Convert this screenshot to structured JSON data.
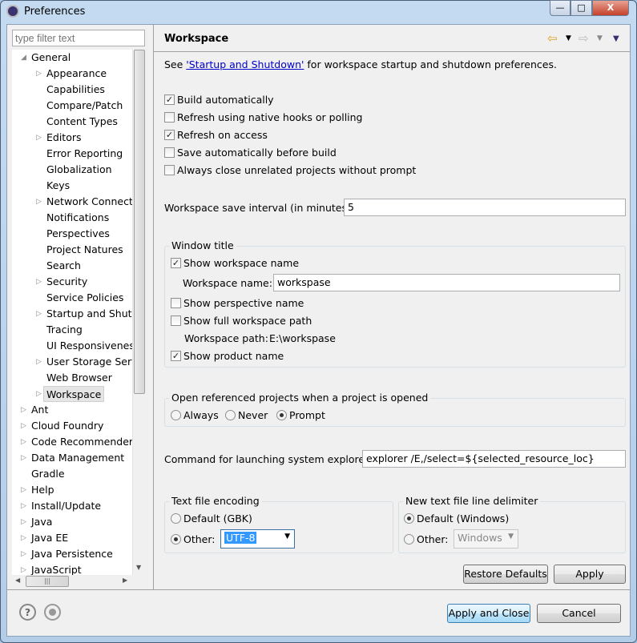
{
  "window": {
    "title": "Preferences",
    "minimize": "—",
    "maximize": "□",
    "close": "X"
  },
  "filter": {
    "placeholder": "type filter text"
  },
  "tree": [
    {
      "label": "General",
      "level": 0,
      "arrow": "expanded"
    },
    {
      "label": "Appearance",
      "level": 1,
      "arrow": "collapsed"
    },
    {
      "label": "Capabilities",
      "level": 1,
      "arrow": "none"
    },
    {
      "label": "Compare/Patch",
      "level": 1,
      "arrow": "none"
    },
    {
      "label": "Content Types",
      "level": 1,
      "arrow": "none"
    },
    {
      "label": "Editors",
      "level": 1,
      "arrow": "collapsed"
    },
    {
      "label": "Error Reporting",
      "level": 1,
      "arrow": "none"
    },
    {
      "label": "Globalization",
      "level": 1,
      "arrow": "none"
    },
    {
      "label": "Keys",
      "level": 1,
      "arrow": "none"
    },
    {
      "label": "Network Connections",
      "level": 1,
      "arrow": "collapsed"
    },
    {
      "label": "Notifications",
      "level": 1,
      "arrow": "none"
    },
    {
      "label": "Perspectives",
      "level": 1,
      "arrow": "none"
    },
    {
      "label": "Project Natures",
      "level": 1,
      "arrow": "none"
    },
    {
      "label": "Search",
      "level": 1,
      "arrow": "none"
    },
    {
      "label": "Security",
      "level": 1,
      "arrow": "collapsed"
    },
    {
      "label": "Service Policies",
      "level": 1,
      "arrow": "none"
    },
    {
      "label": "Startup and Shutdown",
      "level": 1,
      "arrow": "collapsed"
    },
    {
      "label": "Tracing",
      "level": 1,
      "arrow": "none"
    },
    {
      "label": "UI Responsiveness",
      "level": 1,
      "arrow": "none"
    },
    {
      "label": "User Storage Service",
      "level": 1,
      "arrow": "collapsed"
    },
    {
      "label": "Web Browser",
      "level": 1,
      "arrow": "none"
    },
    {
      "label": "Workspace",
      "level": 1,
      "arrow": "collapsed",
      "selected": true
    },
    {
      "label": "Ant",
      "level": 0,
      "arrow": "collapsed"
    },
    {
      "label": "Cloud Foundry",
      "level": 0,
      "arrow": "collapsed"
    },
    {
      "label": "Code Recommenders",
      "level": 0,
      "arrow": "collapsed"
    },
    {
      "label": "Data Management",
      "level": 0,
      "arrow": "collapsed"
    },
    {
      "label": "Gradle",
      "level": 0,
      "arrow": "none"
    },
    {
      "label": "Help",
      "level": 0,
      "arrow": "collapsed"
    },
    {
      "label": "Install/Update",
      "level": 0,
      "arrow": "collapsed"
    },
    {
      "label": "Java",
      "level": 0,
      "arrow": "collapsed"
    },
    {
      "label": "Java EE",
      "level": 0,
      "arrow": "collapsed"
    },
    {
      "label": "Java Persistence",
      "level": 0,
      "arrow": "collapsed"
    },
    {
      "label": "JavaScript",
      "level": 0,
      "arrow": "collapsed"
    }
  ],
  "page": {
    "title": "Workspace",
    "nav_icons": [
      "back-arrow-icon",
      "forward-arrow-icon",
      "view-menu-icon"
    ],
    "intro_prefix": "See ",
    "intro_link": "'Startup and Shutdown'",
    "intro_suffix": " for workspace startup and shutdown preferences.",
    "checkboxes": [
      {
        "label": "Build automatically",
        "checked": true
      },
      {
        "label": "Refresh using native hooks or polling",
        "checked": false
      },
      {
        "label": "Refresh on access",
        "checked": true
      },
      {
        "label": "Save automatically before build",
        "checked": false
      },
      {
        "label": "Always close unrelated projects without prompt",
        "checked": false
      }
    ],
    "save_interval_label": "Workspace save interval (in minutes):",
    "save_interval_value": "5",
    "window_title": {
      "group": "Window title",
      "show_ws_name": {
        "label": "Show workspace name",
        "checked": true
      },
      "ws_name_label": "Workspace name:",
      "ws_name_value": "workspase",
      "show_perspective": {
        "label": "Show perspective name",
        "checked": false
      },
      "show_full_path": {
        "label": "Show full workspace path",
        "checked": false
      },
      "ws_path_label": "Workspace path:",
      "ws_path_value": "E:\\workspase",
      "show_product": {
        "label": "Show product name",
        "checked": true
      }
    },
    "open_ref": {
      "group": "Open referenced projects when a project is opened",
      "options": [
        "Always",
        "Never",
        "Prompt"
      ],
      "selected": "Prompt"
    },
    "explorer_label": "Command for launching system explorer:",
    "explorer_value": "explorer /E,/select=${selected_resource_loc}",
    "encoding": {
      "group": "Text file encoding",
      "default": "Default (GBK)",
      "other": "Other:",
      "value": "UTF-8",
      "selected": "other"
    },
    "delimiter": {
      "group": "New text file line delimiter",
      "default": "Default (Windows)",
      "other": "Other:",
      "value": "Windows",
      "selected": "default"
    },
    "restore_defaults": "Restore Defaults",
    "apply": "Apply"
  },
  "footer": {
    "apply_close": "Apply and Close",
    "cancel": "Cancel",
    "help_icon": "?"
  }
}
